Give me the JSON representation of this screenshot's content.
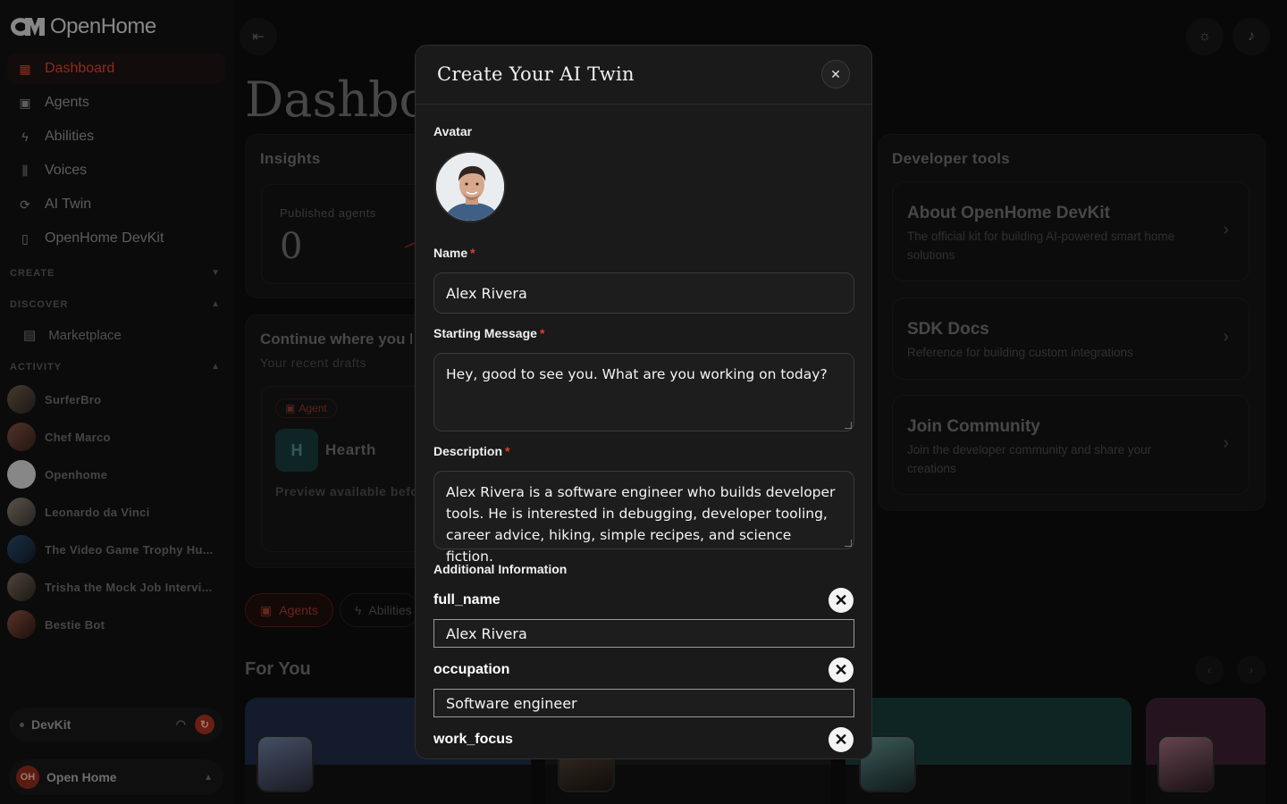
{
  "app": {
    "name": "OpenHome"
  },
  "sidebar": {
    "nav": [
      {
        "label": "Dashboard",
        "icon": "grid-icon",
        "active": true
      },
      {
        "label": "Agents",
        "icon": "agent-icon"
      },
      {
        "label": "Abilities",
        "icon": "bolt-icon"
      },
      {
        "label": "Voices",
        "icon": "waveform-icon"
      },
      {
        "label": "AI Twin",
        "icon": "twin-icon"
      },
      {
        "label": "OpenHome DevKit",
        "icon": "device-icon"
      }
    ],
    "sections": {
      "create": "CREATE",
      "discover": "DISCOVER",
      "activity": "ACTIVITY"
    },
    "marketplace": "Marketplace",
    "activity": [
      "SurferBro",
      "Chef Marco",
      "Openhome",
      "Leonardo da Vinci",
      "The Video Game Trophy Hu...",
      "Trisha the Mock Job Intervi...",
      "Bestie Bot"
    ],
    "devkit": {
      "label": "DevKit"
    },
    "account": {
      "initials": "OH",
      "name": "Open Home"
    }
  },
  "main": {
    "title": "Dashboard",
    "insights": {
      "title": "Insights",
      "stat_label": "Published agents",
      "stat_value": "0"
    },
    "continue": {
      "title": "Continue where you left off",
      "subtitle": "Your recent drafts",
      "badge": "Agent",
      "draft_initial": "H",
      "draft_name": "Hearth",
      "draft_preview": "Preview available before publishing"
    },
    "tabs": {
      "agents": "Agents",
      "abilities": "Abilities"
    },
    "for_you": "For You",
    "developer_tools": {
      "title": "Developer tools",
      "cards": [
        {
          "title": "About OpenHome DevKit",
          "desc": "The official kit for building AI-powered smart home solutions"
        },
        {
          "title": "SDK Docs",
          "desc": "Reference for building custom integrations"
        },
        {
          "title": "Join Community",
          "desc": "Join the developer community and share your creations"
        }
      ]
    }
  },
  "modal": {
    "title": "Create Your AI Twin",
    "avatar_label": "Avatar",
    "name_label": "Name",
    "name_value": "Alex Rivera",
    "starting_label": "Starting Message",
    "starting_value": "Hey, good to see you. What are you working on today?",
    "description_label": "Description",
    "description_value": "Alex Rivera is a software engineer who builds developer tools. He is interested in debugging, developer tooling, career advice, hiking, simple recipes, and science fiction.",
    "additional_label": "Additional Information",
    "fields": [
      {
        "key": "full_name",
        "value": "Alex Rivera"
      },
      {
        "key": "occupation",
        "value": "Software engineer"
      },
      {
        "key": "work_focus",
        "value": ""
      }
    ]
  },
  "colors": {
    "accent": "#e0402a",
    "modal_bg": "#1a1a1a"
  }
}
